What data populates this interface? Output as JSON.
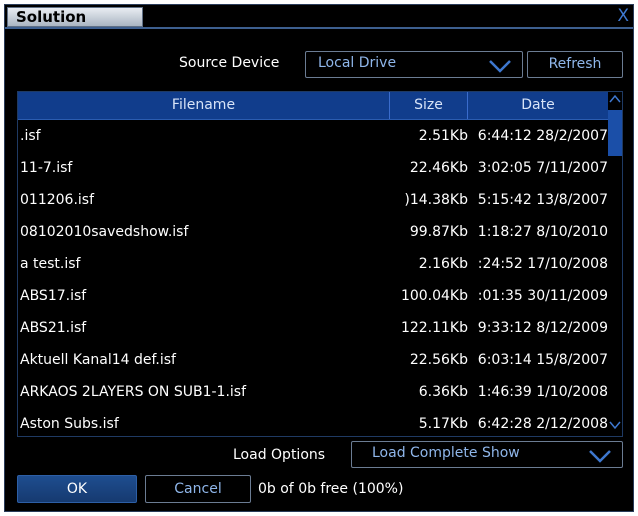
{
  "window": {
    "title": "Solution",
    "close_glyph": "X"
  },
  "source": {
    "label": "Source Device",
    "value": "Local Drive",
    "refresh_label": "Refresh"
  },
  "columns": {
    "filename": "Filename",
    "size": "Size",
    "date": "Date"
  },
  "files": [
    {
      "name": ".isf",
      "size": "2.51Kb",
      "date": "6:44:12 28/2/2007"
    },
    {
      "name": "11-7.isf",
      "size": "22.46Kb",
      "date": "3:02:05 7/11/2007"
    },
    {
      "name": "011206.isf",
      "size": ")14.38Kb",
      "date": "5:15:42 13/8/2007"
    },
    {
      "name": "08102010savedshow.isf",
      "size": "99.87Kb",
      "date": "1:18:27 8/10/2010"
    },
    {
      "name": "a test.isf",
      "size": "2.16Kb",
      "date": ":24:52 17/10/2008"
    },
    {
      "name": "ABS17.isf",
      "size": "100.04Kb",
      "date": ":01:35 30/11/2009"
    },
    {
      "name": "ABS21.isf",
      "size": "122.11Kb",
      "date": "9:33:12 8/12/2009"
    },
    {
      "name": "Aktuell Kanal14 def.isf",
      "size": "22.56Kb",
      "date": "6:03:14 15/8/2007"
    },
    {
      "name": "ARKAOS 2LAYERS ON SUB1-1.isf",
      "size": "6.36Kb",
      "date": "1:46:39 1/10/2008"
    },
    {
      "name": "Aston Subs.isf",
      "size": "5.17Kb",
      "date": "6:42:28 2/12/2008"
    }
  ],
  "load": {
    "label": "Load Options",
    "value": "Load Complete Show"
  },
  "footer": {
    "ok_label": "OK",
    "cancel_label": "Cancel",
    "free_text": "0b of 0b free (100%)"
  },
  "colors": {
    "accent": "#113d8c",
    "text_link": "#8fb6ea",
    "close": "#3e78d0"
  },
  "icons": {
    "close": "close-icon",
    "dropdown": "chevron-down-icon",
    "scroll_up": "arrow-up-icon",
    "scroll_down": "arrow-down-icon"
  }
}
